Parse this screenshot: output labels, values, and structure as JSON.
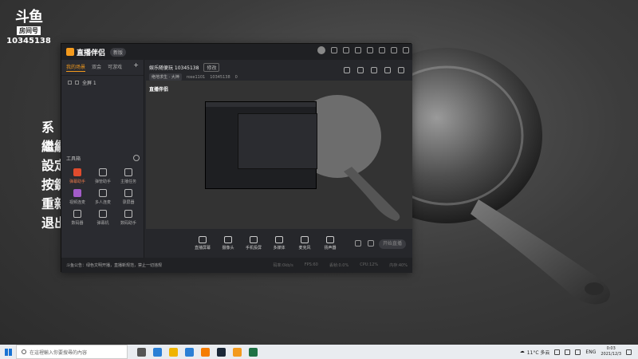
{
  "badge": {
    "logo": "斗鱼",
    "tag": "房间号",
    "room": "10345138"
  },
  "left_text": [
    "系",
    "繼續",
    "設定",
    "按鍵",
    "重新",
    "退出"
  ],
  "app": {
    "brand": "直播伴侣",
    "version": "新版",
    "side_tabs": [
      "我的场景",
      "双会",
      "可游戏"
    ],
    "scene": "全屏 1",
    "toolbox_title": "工具箱",
    "tools": [
      {
        "label": "弹幕助手",
        "style": "hot"
      },
      {
        "label": "弹管助手",
        "style": ""
      },
      {
        "label": "主播任务",
        "style": ""
      },
      {
        "label": "视频连麦",
        "style": "pink"
      },
      {
        "label": "多人连麦",
        "style": ""
      },
      {
        "label": "录屏器",
        "style": ""
      },
      {
        "label": "数码器",
        "style": ""
      },
      {
        "label": "弹幕机",
        "style": ""
      },
      {
        "label": "数码助手",
        "style": ""
      }
    ],
    "stream_title": "娱乐随便玩 10345138",
    "edit_label": "修改",
    "meta": {
      "category": "绝地求生 · 大神",
      "user": "rose1101",
      "room": "10345138",
      "viewers": "0"
    },
    "preview_logo": "直播伴侣",
    "preview_url": "http://live.douyu.com/10345138",
    "controls": [
      "直播屏幕",
      "摄像头",
      "手机投屏",
      "多媒体",
      "麦克风",
      "扬声器"
    ],
    "live_button": "开始直播",
    "status_notice": "斗鱼公告：绿色文明开播，直播新规范，禁止一切违规",
    "stats": [
      "码率:0kb/s",
      "FPS:60",
      "丢帧:0.0%",
      "CPU:12%",
      "内存:40%"
    ]
  },
  "taskbar": {
    "search_placeholder": "在這裡輸入你要搜尋的內容",
    "weather": "11°C 多云",
    "lang": "ENG",
    "time": "0:03",
    "date": "2021/12/3",
    "icon_colors": [
      "#555",
      "#2a7fd5",
      "#f0b400",
      "#2a7fd5",
      "#f57c00",
      "#1b2838",
      "#f39a1d",
      "#1e7145"
    ]
  }
}
